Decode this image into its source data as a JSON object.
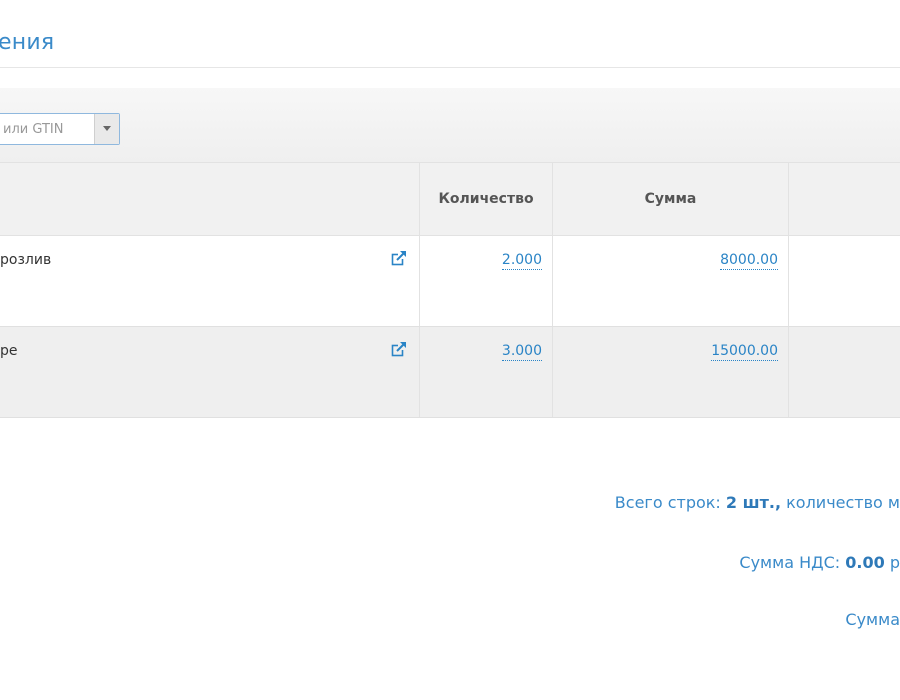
{
  "page": {
    "title": "ения"
  },
  "search": {
    "placeholder": "или GTIN"
  },
  "table": {
    "columns": [
      "Количество",
      "Сумма"
    ],
    "rows": [
      {
        "name": "розлив",
        "quantity": "2.000",
        "sum": "8000.00"
      },
      {
        "name": "ре",
        "quantity": "3.000",
        "sum": "15000.00"
      }
    ]
  },
  "summary": {
    "rows_prefix": "Всего строк:",
    "rows_value": "2 шт.,",
    "rows_suffix": "количество м",
    "vat_prefix": "Сумма НДС:",
    "vat_value": "0.00",
    "vat_suffix": "р",
    "total_prefix": "Сумма"
  },
  "colors": {
    "accent": "#3a8ac9",
    "link": "#2a84c6"
  },
  "icons": {
    "external_link": "external-link-icon",
    "dropdown": "caret-down-icon"
  }
}
